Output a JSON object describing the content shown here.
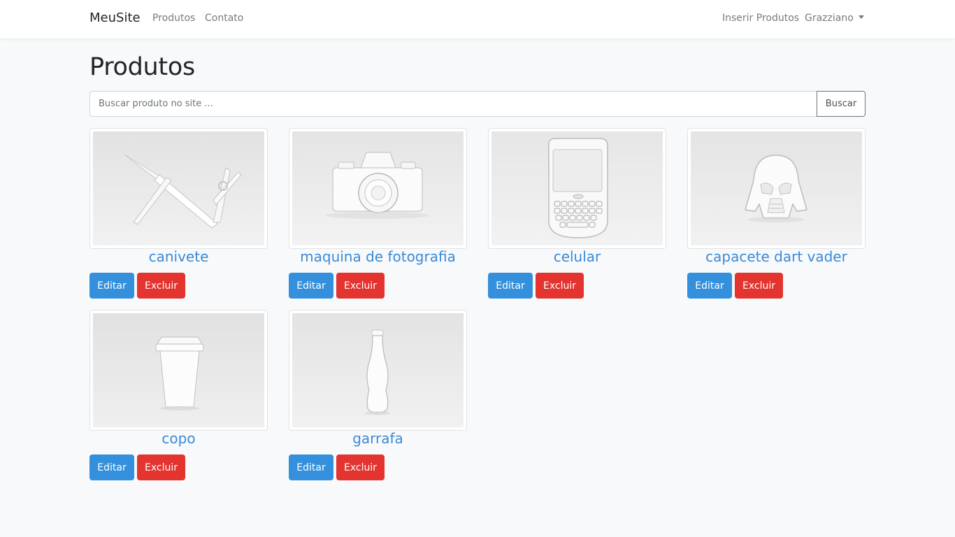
{
  "navbar": {
    "brand": "MeuSite",
    "links": [
      "Produtos",
      "Contato"
    ],
    "insert_link": "Inserir Produtos",
    "user_menu": "Grazziano"
  },
  "page": {
    "title": "Produtos"
  },
  "search": {
    "placeholder": "Buscar produto no site ...",
    "button": "Buscar"
  },
  "products": [
    {
      "name": "canivete",
      "image": "pocket-knife-image",
      "edit": "Editar",
      "delete": "Excluir"
    },
    {
      "name": "maquina de fotografia",
      "image": "camera-image",
      "edit": "Editar",
      "delete": "Excluir"
    },
    {
      "name": "celular",
      "image": "phone-image",
      "edit": "Editar",
      "delete": "Excluir"
    },
    {
      "name": "capacete dart vader",
      "image": "helmet-image",
      "edit": "Editar",
      "delete": "Excluir"
    },
    {
      "name": "copo",
      "image": "cup-image",
      "edit": "Editar",
      "delete": "Excluir"
    },
    {
      "name": "garrafa",
      "image": "bottle-image",
      "edit": "Editar",
      "delete": "Excluir"
    }
  ],
  "colors": {
    "primary": "#3490dc",
    "danger": "#e3342f",
    "link": "#3a8ad8",
    "background": "#f8f9fa"
  }
}
